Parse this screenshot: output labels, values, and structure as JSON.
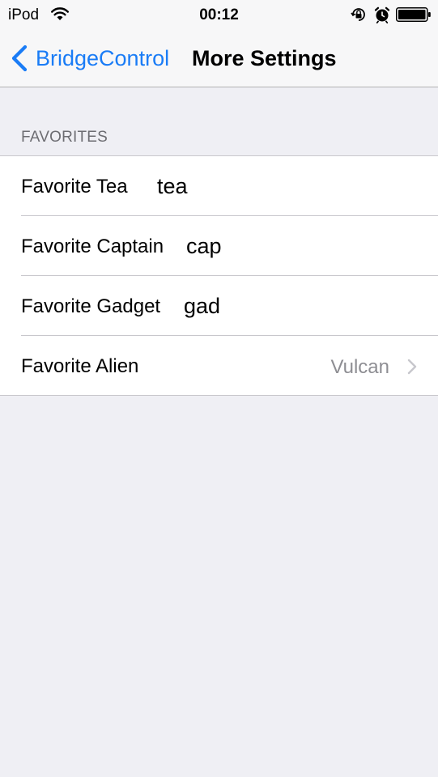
{
  "status_bar": {
    "carrier": "iPod",
    "time": "00:12",
    "icons": [
      "wifi-icon",
      "lock-rotation-icon",
      "alarm-icon",
      "battery-icon"
    ]
  },
  "nav": {
    "back_label": "BridgeControl",
    "title": "More Settings",
    "accent_color": "#1a7cf6"
  },
  "section": {
    "header": "FAVORITES",
    "rows": [
      {
        "label": "Favorite Tea",
        "value": "tea",
        "type": "text-field"
      },
      {
        "label": "Favorite Captain",
        "value": "cap",
        "type": "text-field"
      },
      {
        "label": "Favorite Gadget",
        "value": "gad",
        "type": "text-field"
      },
      {
        "label": "Favorite Alien",
        "value": "Vulcan",
        "type": "disclosure",
        "icon": "chevron-right-icon"
      }
    ]
  }
}
